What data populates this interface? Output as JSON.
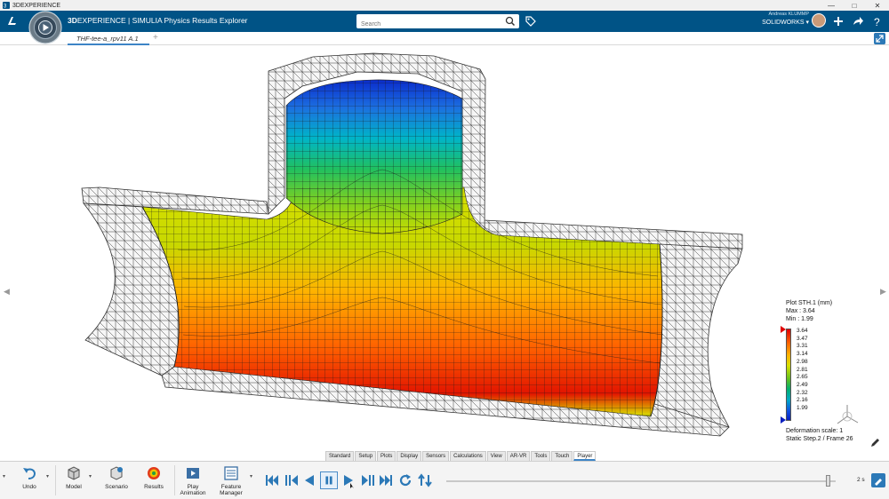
{
  "window": {
    "title": "3DEXPERIENCE"
  },
  "header": {
    "brand_bold": "3D",
    "brand_rest": "EXPERIENCE | SIMULIA Physics Results Explorer",
    "search_placeholder": "Search",
    "user_name": "Andreas KLUMMP",
    "user_product": "SOLIDWORKS"
  },
  "tabs": {
    "active": "THF-tee-a_rpv11 A.1",
    "add": "+"
  },
  "legend": {
    "title": "Plot STH.1 (mm)",
    "max": "Max : 3.64",
    "min": "Min : 1.99",
    "ticks": [
      "3.64",
      "3.47",
      "3.31",
      "3.14",
      "2.98",
      "2.81",
      "2.65",
      "2.49",
      "2.32",
      "2.16",
      "1.99"
    ],
    "max_color": "#e00000",
    "min_color": "#0a20c0",
    "deformation_scale": "Deformation scale: 1",
    "step_frame": "Static Step.2 / Frame 26"
  },
  "bottom_tabs": [
    "Standard",
    "Setup",
    "Plots",
    "Display",
    "Sensors",
    "Calculations",
    "View",
    "AR-VR",
    "Tools",
    "Touch",
    "Player"
  ],
  "active_bottom_tab": "Player",
  "actions": [
    {
      "label": "Undo",
      "icon": "undo-icon"
    },
    {
      "label": "Model",
      "icon": "model-icon"
    },
    {
      "label": "Scenario",
      "icon": "scenario-icon"
    },
    {
      "label": "Results",
      "icon": "results-icon"
    },
    {
      "label1": "Play",
      "label2": "Animation",
      "icon": "play-animation-icon"
    },
    {
      "label1": "Feature",
      "label2": "Manager",
      "icon": "feature-manager-icon"
    }
  ],
  "player": {
    "speed": "2 s",
    "progress": 0.98
  },
  "colors": {
    "appbar": "#005386",
    "accent": "#3d84c6",
    "player_blue": "#2c79b7"
  }
}
